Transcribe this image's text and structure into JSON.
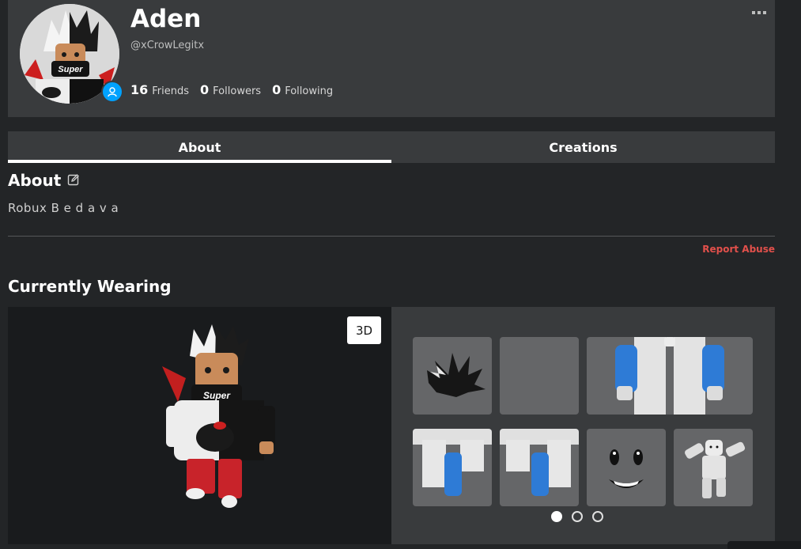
{
  "profile": {
    "display_name": "Aden",
    "username": "@xCrowLegitx",
    "stats": [
      {
        "count": "16",
        "label": "Friends"
      },
      {
        "count": "0",
        "label": "Followers"
      },
      {
        "count": "0",
        "label": "Following"
      }
    ],
    "avatar_shirt_text": "Super"
  },
  "tabs": [
    {
      "label": "About",
      "active": true
    },
    {
      "label": "Creations",
      "active": false
    }
  ],
  "about": {
    "heading": "About",
    "text": "Robux B e d a v a",
    "report_label": "Report Abuse"
  },
  "wearing": {
    "heading": "Currently Wearing",
    "toggle_label": "3D",
    "items": [
      {
        "name": "spiky-hair"
      },
      {
        "name": "empty"
      },
      {
        "name": "checkered-arms"
      },
      {
        "name": "checkered-leg-left"
      },
      {
        "name": "checkered-leg-right"
      },
      {
        "name": "smile-face"
      },
      {
        "name": "animation-pose"
      }
    ],
    "pages": 3,
    "current_page": 1
  },
  "colors": {
    "accent_blue": "#00a2ff",
    "report_red": "#e2504b",
    "background": "#232527",
    "card": "#393b3d"
  }
}
